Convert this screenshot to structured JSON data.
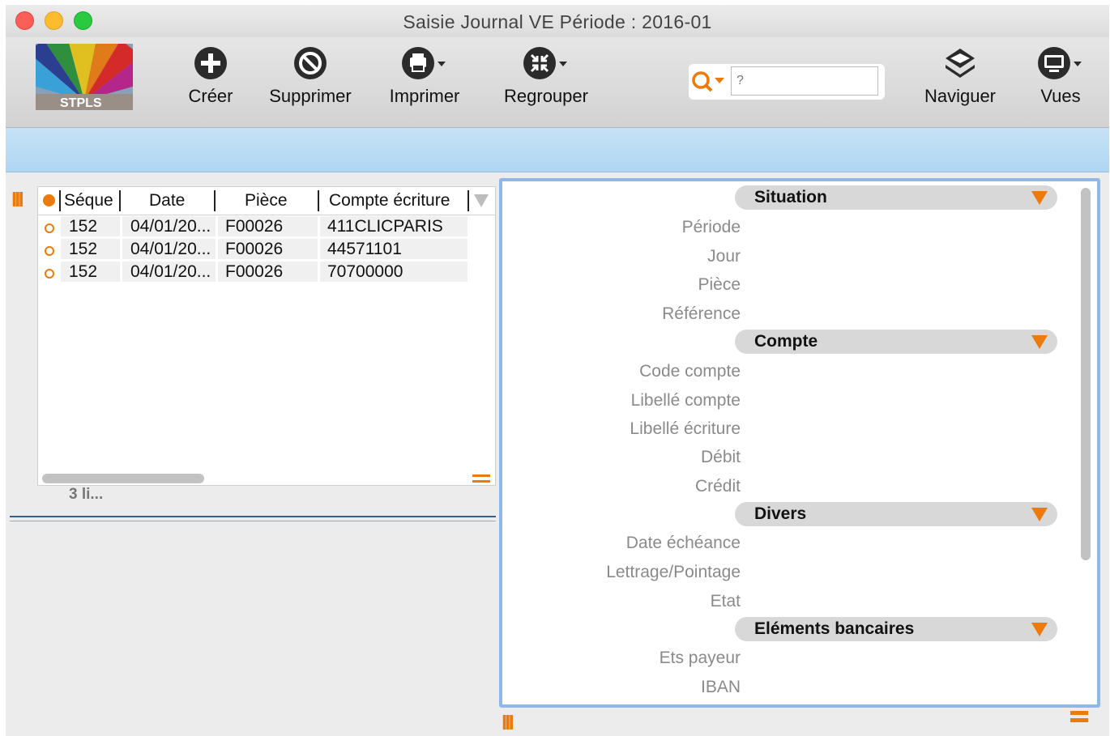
{
  "window": {
    "title": "Saisie Journal VE Période : 2016-01"
  },
  "toolbar": {
    "logo_text": "STPLS",
    "create_label": "Créer",
    "delete_label": "Supprimer",
    "print_label": "Imprimer",
    "group_label": "Regrouper",
    "search_placeholder": "?",
    "navigate_label": "Naviguer",
    "views_label": "Vues"
  },
  "table": {
    "columns": [
      "Séque",
      "Date",
      "Pièce",
      "Compte écriture"
    ],
    "rows": [
      {
        "seq": "152",
        "date": "04/01/20...",
        "piece": "F00026",
        "compte": "411CLICPARIS"
      },
      {
        "seq": "152",
        "date": "04/01/20...",
        "piece": "F00026",
        "compte": "44571101"
      },
      {
        "seq": "152",
        "date": "04/01/20...",
        "piece": "F00026",
        "compte": "70700000"
      }
    ],
    "count_label": "3 li..."
  },
  "detail": {
    "sections": {
      "situation": "Situation",
      "compte": "Compte",
      "divers": "Divers",
      "bancaires": "Eléments bancaires"
    },
    "fields": {
      "periode": "Période",
      "jour": "Jour",
      "piece": "Pièce",
      "reference": "Référence",
      "code_compte": "Code compte",
      "libelle_compte": "Libellé compte",
      "libelle_ecriture": "Libellé écriture",
      "debit": "Débit",
      "credit": "Crédit",
      "date_echeance": "Date échéance",
      "lettrage": "Lettrage/Pointage",
      "etat": "Etat",
      "ets_payeur": "Ets payeur",
      "iban": "IBAN"
    }
  },
  "colors": {
    "accent": "#ec7a0c",
    "band": "#c6e2f6",
    "focus_border": "#8fb8e8"
  }
}
